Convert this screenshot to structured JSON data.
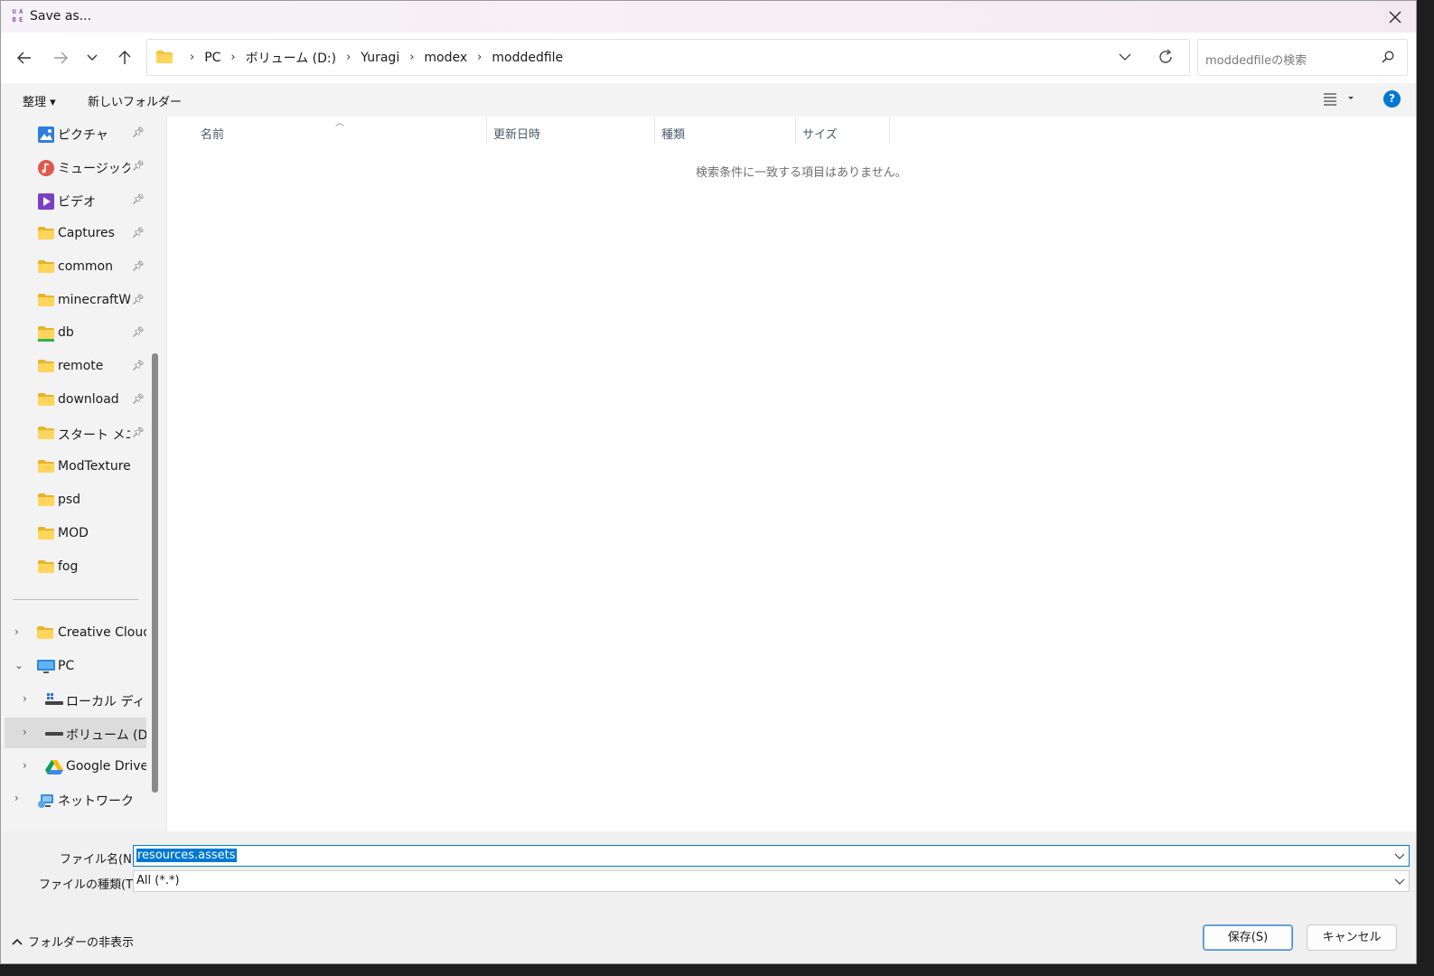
{
  "window": {
    "title": "Save as...",
    "app_icon_letters": [
      "U",
      "A",
      "B",
      "E"
    ]
  },
  "address": {
    "crumbs": [
      "PC",
      "ボリューム (D:)",
      "Yuragi",
      "modex",
      "moddedfile"
    ],
    "separator": "›"
  },
  "search": {
    "placeholder": "moddedfileの検索"
  },
  "toolbar": {
    "organize_label": "整理 ▾",
    "new_folder_label": "新しいフォルダー"
  },
  "sidebar": {
    "quick": [
      {
        "label": "ピクチャ",
        "icon": "pictures-icon",
        "pinned": true
      },
      {
        "label": "ミュージック",
        "icon": "music-icon",
        "pinned": true
      },
      {
        "label": "ビデオ",
        "icon": "video-icon",
        "pinned": true
      },
      {
        "label": "Captures",
        "icon": "folder-icon",
        "pinned": true
      },
      {
        "label": "common",
        "icon": "folder-icon",
        "pinned": true
      },
      {
        "label": "minecraftWorl",
        "icon": "folder-icon",
        "pinned": true
      },
      {
        "label": "db",
        "icon": "folder-green-icon",
        "pinned": true
      },
      {
        "label": "remote",
        "icon": "folder-icon",
        "pinned": true
      },
      {
        "label": "download",
        "icon": "folder-icon",
        "pinned": true
      },
      {
        "label": "スタート メニュー",
        "icon": "folder-icon",
        "pinned": true
      },
      {
        "label": "ModTexture",
        "icon": "folder-icon",
        "pinned": false
      },
      {
        "label": "psd",
        "icon": "folder-icon",
        "pinned": false
      },
      {
        "label": "MOD",
        "icon": "folder-icon",
        "pinned": false
      },
      {
        "label": "fog",
        "icon": "folder-icon",
        "pinned": false
      }
    ],
    "tree": [
      {
        "label": "Creative Cloud Files",
        "icon": "folder-icon",
        "chevron": "›"
      },
      {
        "label": "PC",
        "icon": "pc-icon",
        "chevron": "⌄"
      },
      {
        "label": "ローカル ディスク (C:)",
        "icon": "local-disk-icon",
        "chevron": "›"
      },
      {
        "label": "ボリューム (D:)",
        "icon": "drive-icon",
        "chevron": "›"
      },
      {
        "label": "Google Drive (G:)",
        "icon": "google-drive-icon",
        "chevron": "›"
      },
      {
        "label": "ネットワーク",
        "icon": "network-icon",
        "chevron": "›"
      }
    ]
  },
  "columns": {
    "name": "名前",
    "modified": "更新日時",
    "type": "種類",
    "size": "サイズ"
  },
  "empty_message": "検索条件に一致する項目はありません。",
  "form": {
    "filename_label": "ファイル名(N):",
    "filename_value": "resources.assets",
    "filetype_label": "ファイルの種類(T):",
    "filetype_value": "All (*.*)"
  },
  "footer": {
    "hide_folders": "フォルダーの非表示",
    "save": "保存(S)",
    "cancel": "キャンセル"
  },
  "colors": {
    "accent": "#0078d4",
    "folder": "#f5c33b",
    "selected_row": "#dcdcdc"
  }
}
